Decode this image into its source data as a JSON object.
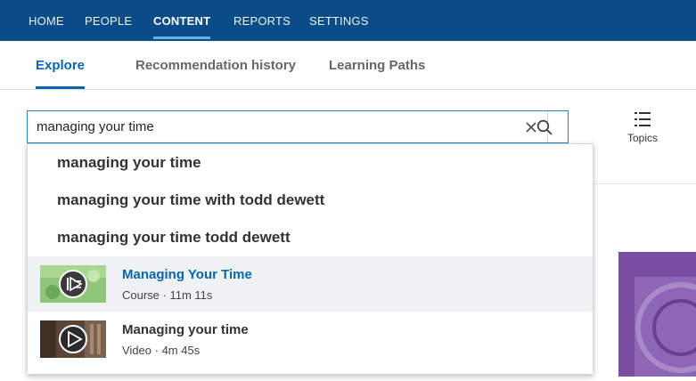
{
  "topnav": {
    "items": [
      {
        "label": "HOME",
        "active": false
      },
      {
        "label": "PEOPLE",
        "active": false
      },
      {
        "label": "CONTENT",
        "active": true
      },
      {
        "label": "REPORTS",
        "active": false
      },
      {
        "label": "SETTINGS",
        "active": false
      }
    ]
  },
  "subtabs": {
    "explore": "Explore",
    "recommendation_history": "Recommendation history",
    "learning_paths": "Learning Paths",
    "active": "Explore"
  },
  "search": {
    "value": "managing your time",
    "clear_icon": "close-icon",
    "search_icon": "search-icon"
  },
  "topics": {
    "label": "Topics",
    "icon": "list-icon"
  },
  "dropdown": {
    "suggestions": [
      "managing your time",
      "managing your time with todd dewett",
      "managing your time todd dewett"
    ],
    "results": [
      {
        "title": "Managing Your Time",
        "type": "Course",
        "duration": "11m 11s",
        "highlighted": true
      },
      {
        "title": "Managing your time",
        "type": "Video",
        "duration": "4m 45s",
        "highlighted": false
      }
    ],
    "meta_separator": " · "
  },
  "colors": {
    "topnav_bg": "#0a4c86",
    "accent": "#0a66a8",
    "highlight_bg": "#eef2f5",
    "promo_card": "#7a4fa3"
  }
}
